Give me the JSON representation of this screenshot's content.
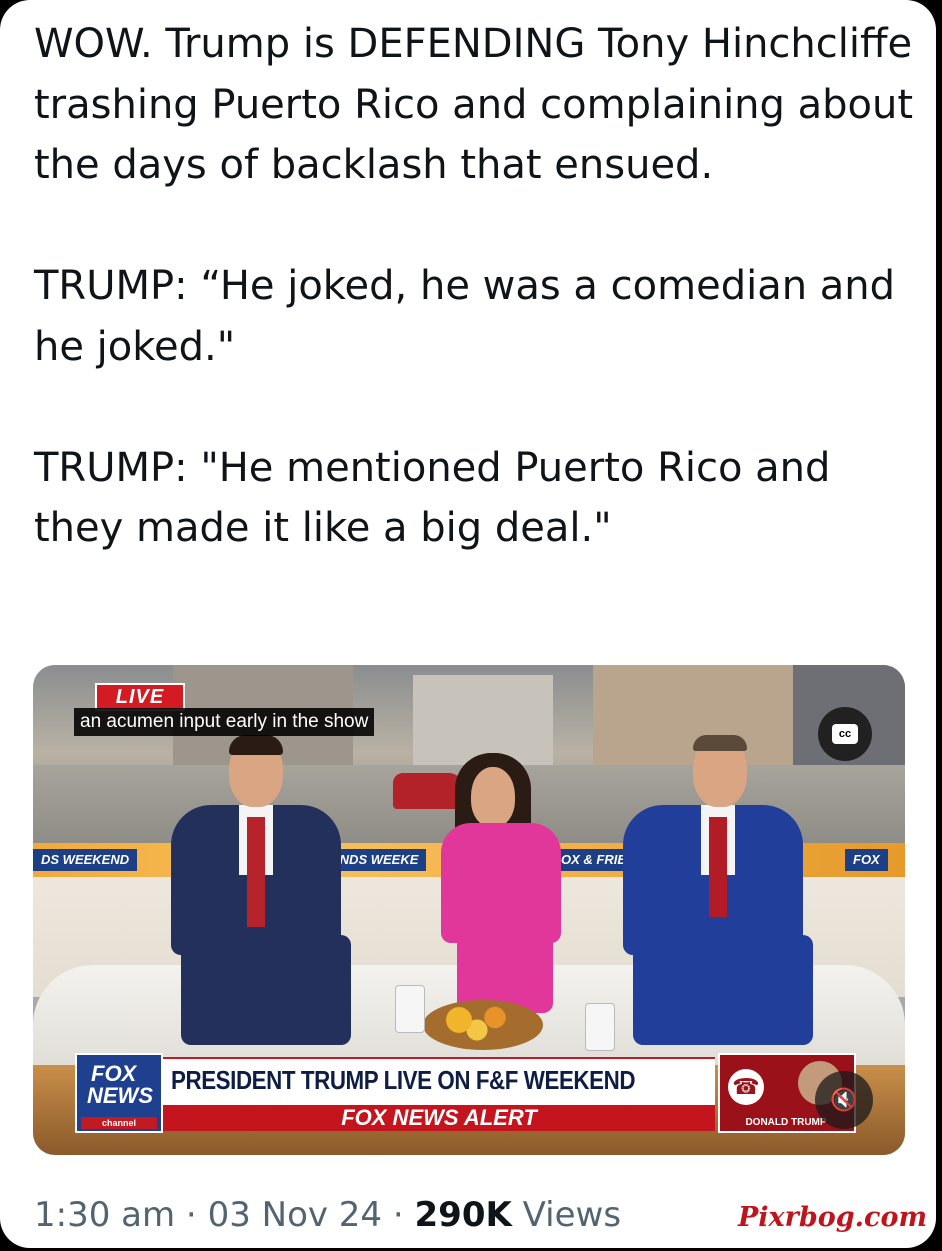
{
  "tweet": {
    "text": "WOW. Trump is DEFENDING Tony Hinchcliffe trashing Puerto Rico and complaining about the days of backlash that ensued.\n\nTRUMP: “He joked, he was a comedian and he joked.\"\n\nTRUMP: \"He mentioned Puerto Rico and they made it like a big deal.\"",
    "time": "1:30 am",
    "date": "03 Nov 24",
    "views_count": "290K",
    "views_label": "Views",
    "separator": " · "
  },
  "video": {
    "live_badge": "LIVE",
    "caption": "an acumen input early in the show",
    "cc_label": "cc",
    "ticker_segments": [
      "DS WEEKEND",
      "ENDS WEEKE",
      "OX & FRIE",
      "FOX"
    ],
    "lower_third": {
      "logo_line1": "FOX",
      "logo_line2": "NEWS",
      "logo_line3": "channel",
      "headline": "PRESIDENT TRUMP LIVE ON F&F WEEKEND",
      "alert": "FOX NEWS ALERT",
      "phone_name": "DONALD TRUMP"
    },
    "mute_icon": "mute-icon",
    "phone_icon": "phone-icon"
  },
  "watermark": "Pixrbog.com",
  "colors": {
    "text": "#0f1419",
    "meta": "#536471",
    "fox_blue": "#1f3f8f",
    "alert_red": "#c4151f"
  }
}
